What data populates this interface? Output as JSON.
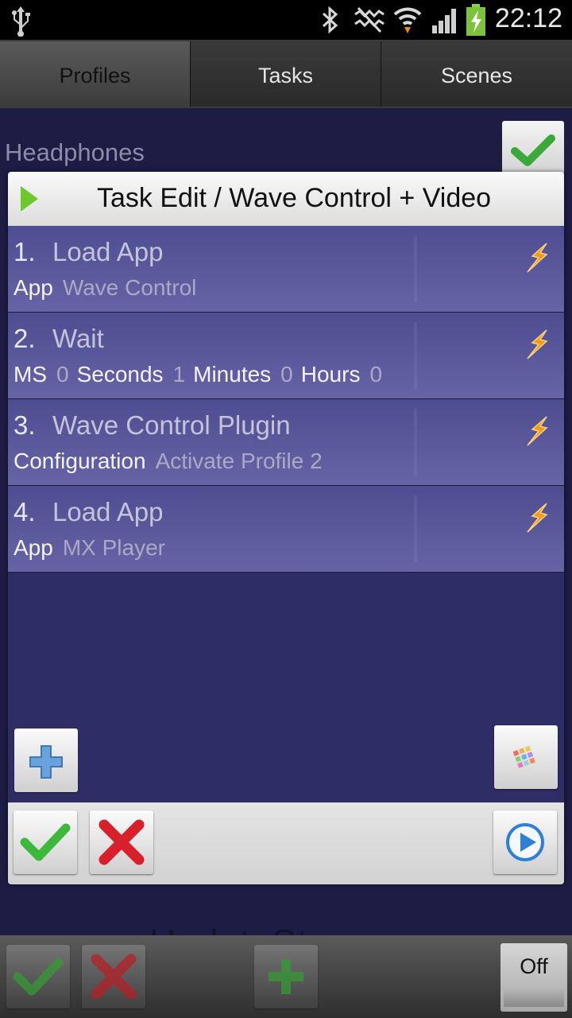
{
  "status_bar": {
    "time": "22:12",
    "icons": [
      "usb-icon",
      "bluetooth-icon",
      "mute-icon",
      "wifi-icon",
      "signal-icon",
      "battery-charging-icon"
    ]
  },
  "tabs": [
    {
      "label": "Profiles",
      "active": true
    },
    {
      "label": "Tasks",
      "active": false
    },
    {
      "label": "Scenes",
      "active": false
    }
  ],
  "background": {
    "profile_name": "Headphones"
  },
  "dialog": {
    "title": "Task Edit / Wave Control + Video",
    "actions": [
      {
        "num": "1.",
        "name": "Load App",
        "params": [
          {
            "key": "App",
            "value": "Wave Control"
          }
        ]
      },
      {
        "num": "2.",
        "name": "Wait",
        "params": [
          {
            "key": "MS",
            "value": "0"
          },
          {
            "key": "Seconds",
            "value": "1"
          },
          {
            "key": "Minutes",
            "value": "0"
          },
          {
            "key": "Hours",
            "value": "0"
          }
        ]
      },
      {
        "num": "3.",
        "name": "Wave Control Plugin",
        "params": [
          {
            "key": "Configuration",
            "value": "Activate Profile 2"
          }
        ]
      },
      {
        "num": "4.",
        "name": "Load App",
        "params": [
          {
            "key": "App",
            "value": "MX Player"
          }
        ]
      }
    ]
  },
  "bottom_bar": {
    "watermark": "UpdateStar.com",
    "toggle_label": "Off"
  },
  "colors": {
    "page_bg": "#1f1d45",
    "dialog_bg": "#2e2d66",
    "action_row": "#5a59a0",
    "check_green": "#3cb83a",
    "cross_red": "#d8202a",
    "play_blue": "#2f7fd6"
  }
}
